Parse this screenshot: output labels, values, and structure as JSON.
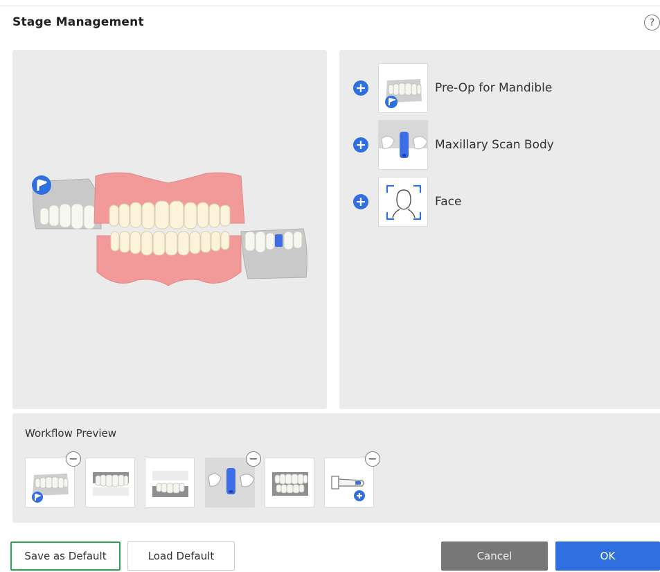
{
  "dialog": {
    "title": "Stage Management",
    "help_label": "?"
  },
  "stages_available": [
    {
      "label": "Pre-Op for Mandible",
      "icon": "pre-op-mandible-icon"
    },
    {
      "label": "Maxillary Scan Body",
      "icon": "maxillary-scan-body-icon"
    },
    {
      "label": "Face",
      "icon": "face-icon"
    }
  ],
  "add_symbol": "+",
  "workflow": {
    "title": "Workflow Preview",
    "remove_symbol": "−",
    "items": [
      {
        "icon": "pre-op-stage-icon",
        "removable": true
      },
      {
        "icon": "maxilla-stage-icon",
        "removable": false
      },
      {
        "icon": "mandible-stage-icon",
        "removable": false
      },
      {
        "icon": "scan-body-stage-icon",
        "removable": true,
        "selected": true
      },
      {
        "icon": "occlusion-stage-icon",
        "removable": false
      },
      {
        "icon": "add-on-stage-icon",
        "removable": true
      }
    ]
  },
  "buttons": {
    "save_default": "Save as Default",
    "load_default": "Load Default",
    "cancel": "Cancel",
    "ok": "OK"
  },
  "colors": {
    "accent": "#2f6fe0",
    "gum": "#f29a9a",
    "panel": "#ebebeb",
    "highlight_border": "#2aa352"
  }
}
